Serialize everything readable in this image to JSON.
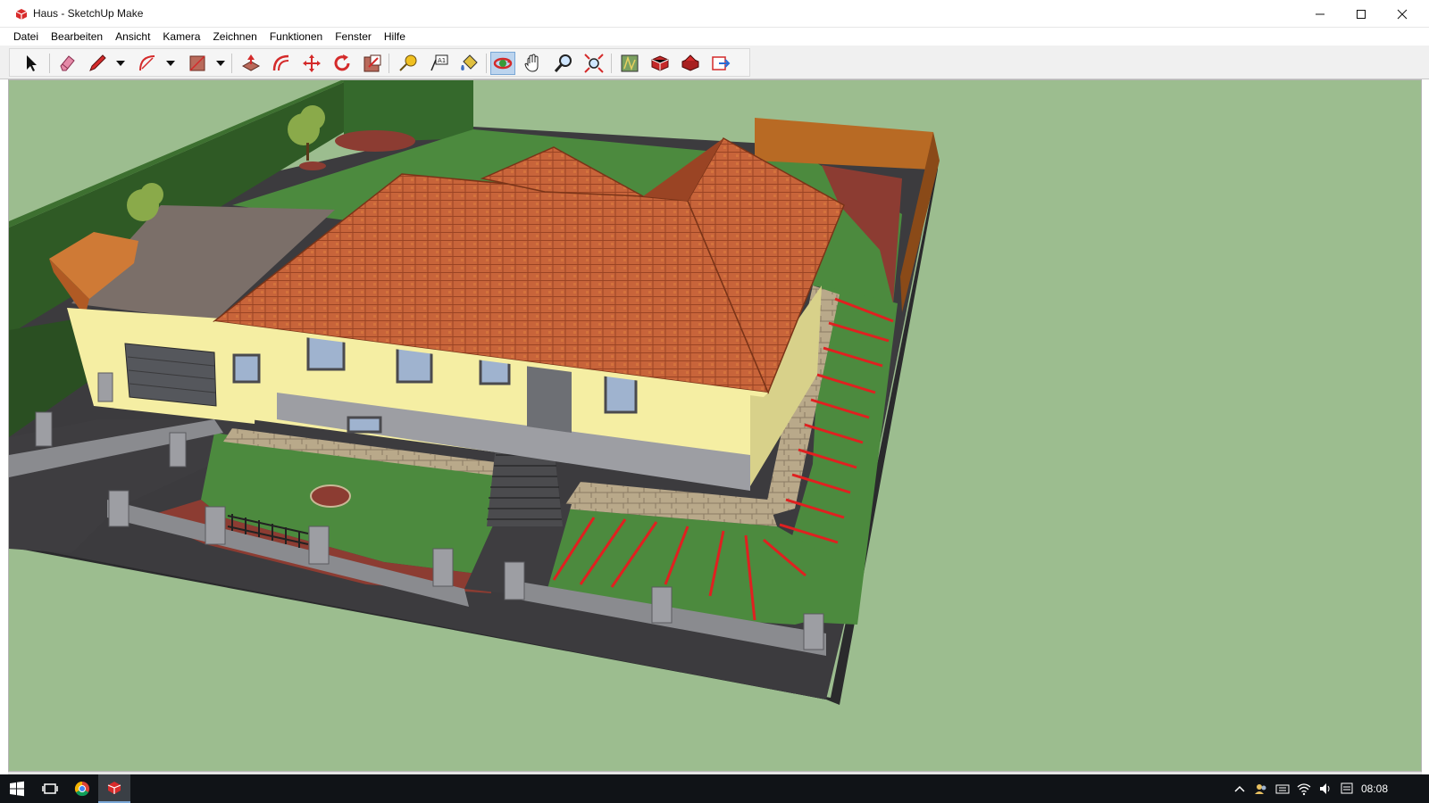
{
  "window": {
    "title": "Haus - SketchUp Make",
    "app_icon": "sketchup-icon",
    "controls": [
      "minimize-icon",
      "maximize-icon",
      "close-icon"
    ]
  },
  "menu": [
    "Datei",
    "Bearbeiten",
    "Ansicht",
    "Kamera",
    "Zeichnen",
    "Funktionen",
    "Fenster",
    "Hilfe"
  ],
  "toolbar": {
    "tools": [
      {
        "icon": "select-arrow-icon"
      },
      {
        "icon": "eraser-icon"
      },
      {
        "icon": "pencil-line-icon",
        "dropdown": true
      },
      {
        "icon": "arc-icon",
        "dropdown": true
      },
      {
        "icon": "rectangle-icon",
        "dropdown": true
      },
      {
        "icon": "push-pull-icon"
      },
      {
        "icon": "offset-icon"
      },
      {
        "icon": "move-icon"
      },
      {
        "icon": "rotate-icon"
      },
      {
        "icon": "scale-icon"
      },
      {
        "icon": "tape-measure-icon"
      },
      {
        "icon": "text-icon"
      },
      {
        "icon": "paint-bucket-icon"
      },
      {
        "icon": "orbit-icon",
        "active": true
      },
      {
        "icon": "pan-icon"
      },
      {
        "icon": "zoom-icon"
      },
      {
        "icon": "zoom-extents-icon"
      },
      {
        "icon": "add-location-icon"
      },
      {
        "icon": "3d-warehouse-icon"
      },
      {
        "icon": "extension-warehouse-icon"
      },
      {
        "icon": "send-to-layout-icon"
      }
    ]
  },
  "viewport": {
    "background": "#9cbd8f",
    "model": "house-with-garden"
  },
  "colors": {
    "roof": "#c8643a",
    "wall": "#f5eea3",
    "lawn": "#4c8a3e",
    "hedge": "#2f5a25",
    "pavement": "#3e3d40",
    "accent_lines": "#e02020"
  },
  "taskbar": {
    "items": [
      "windows-start-icon",
      "task-view-icon",
      "chrome-icon",
      "sketchup-taskbar-icon"
    ],
    "tray": [
      "chevron-up-icon",
      "people-icon",
      "keyboard-icon",
      "wifi-icon",
      "speaker-icon",
      "action-center-icon"
    ],
    "clock": "08:08"
  }
}
